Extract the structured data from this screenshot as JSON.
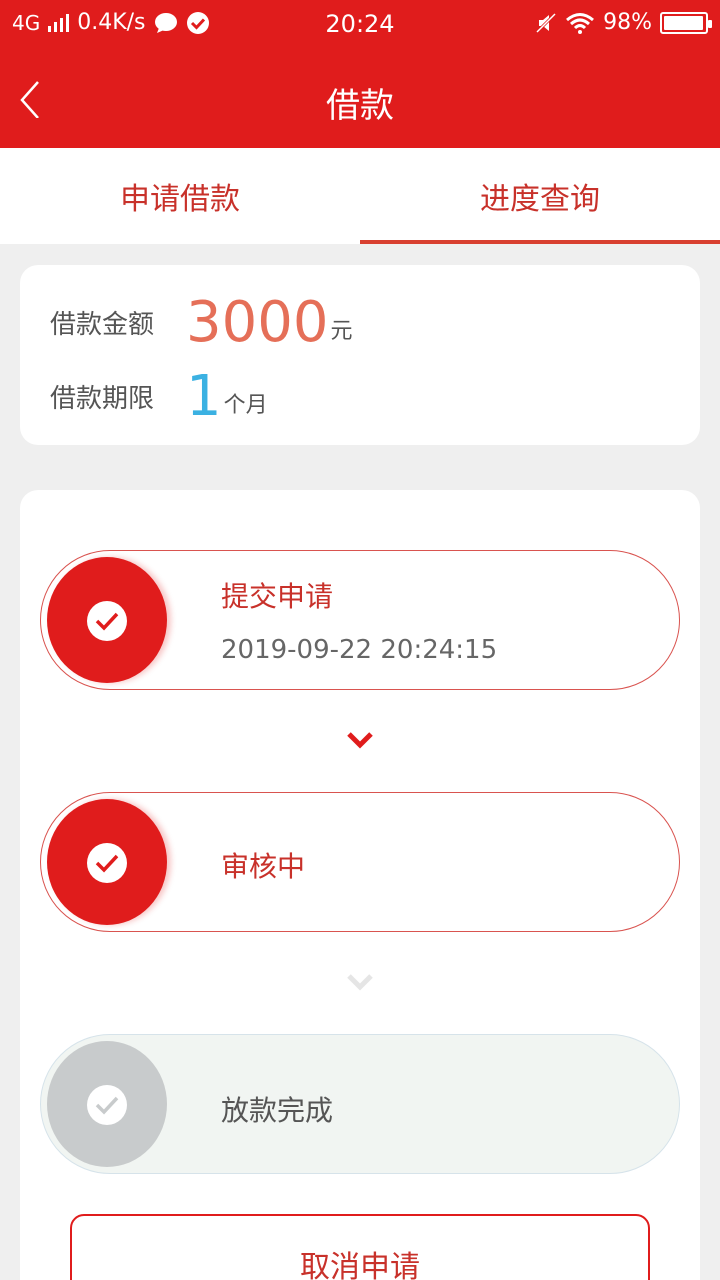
{
  "status_bar": {
    "network": "4G",
    "speed": "0.4K/s",
    "time": "20:24",
    "battery": "98%",
    "battery_level": 0.98
  },
  "app_bar": {
    "title": "借款"
  },
  "tabs": [
    {
      "label": "申请借款",
      "active": false
    },
    {
      "label": "进度查询",
      "active": true
    }
  ],
  "loan": {
    "amount_label": "借款金额",
    "amount_value": "3000",
    "amount_unit": "元",
    "term_label": "借款期限",
    "term_value": "1",
    "term_unit": "个月"
  },
  "steps": [
    {
      "title": "提交申请",
      "time": "2019-09-22 20:24:15",
      "state": "done"
    },
    {
      "title": "审核中",
      "time": "",
      "state": "done"
    },
    {
      "title": "放款完成",
      "time": "",
      "state": "pending"
    }
  ],
  "cancel_label": "取消申请",
  "colors": {
    "primary": "#e01c1c",
    "amount": "#e56f58",
    "term": "#3bb1e2",
    "inactive": "#c8cbcc"
  }
}
